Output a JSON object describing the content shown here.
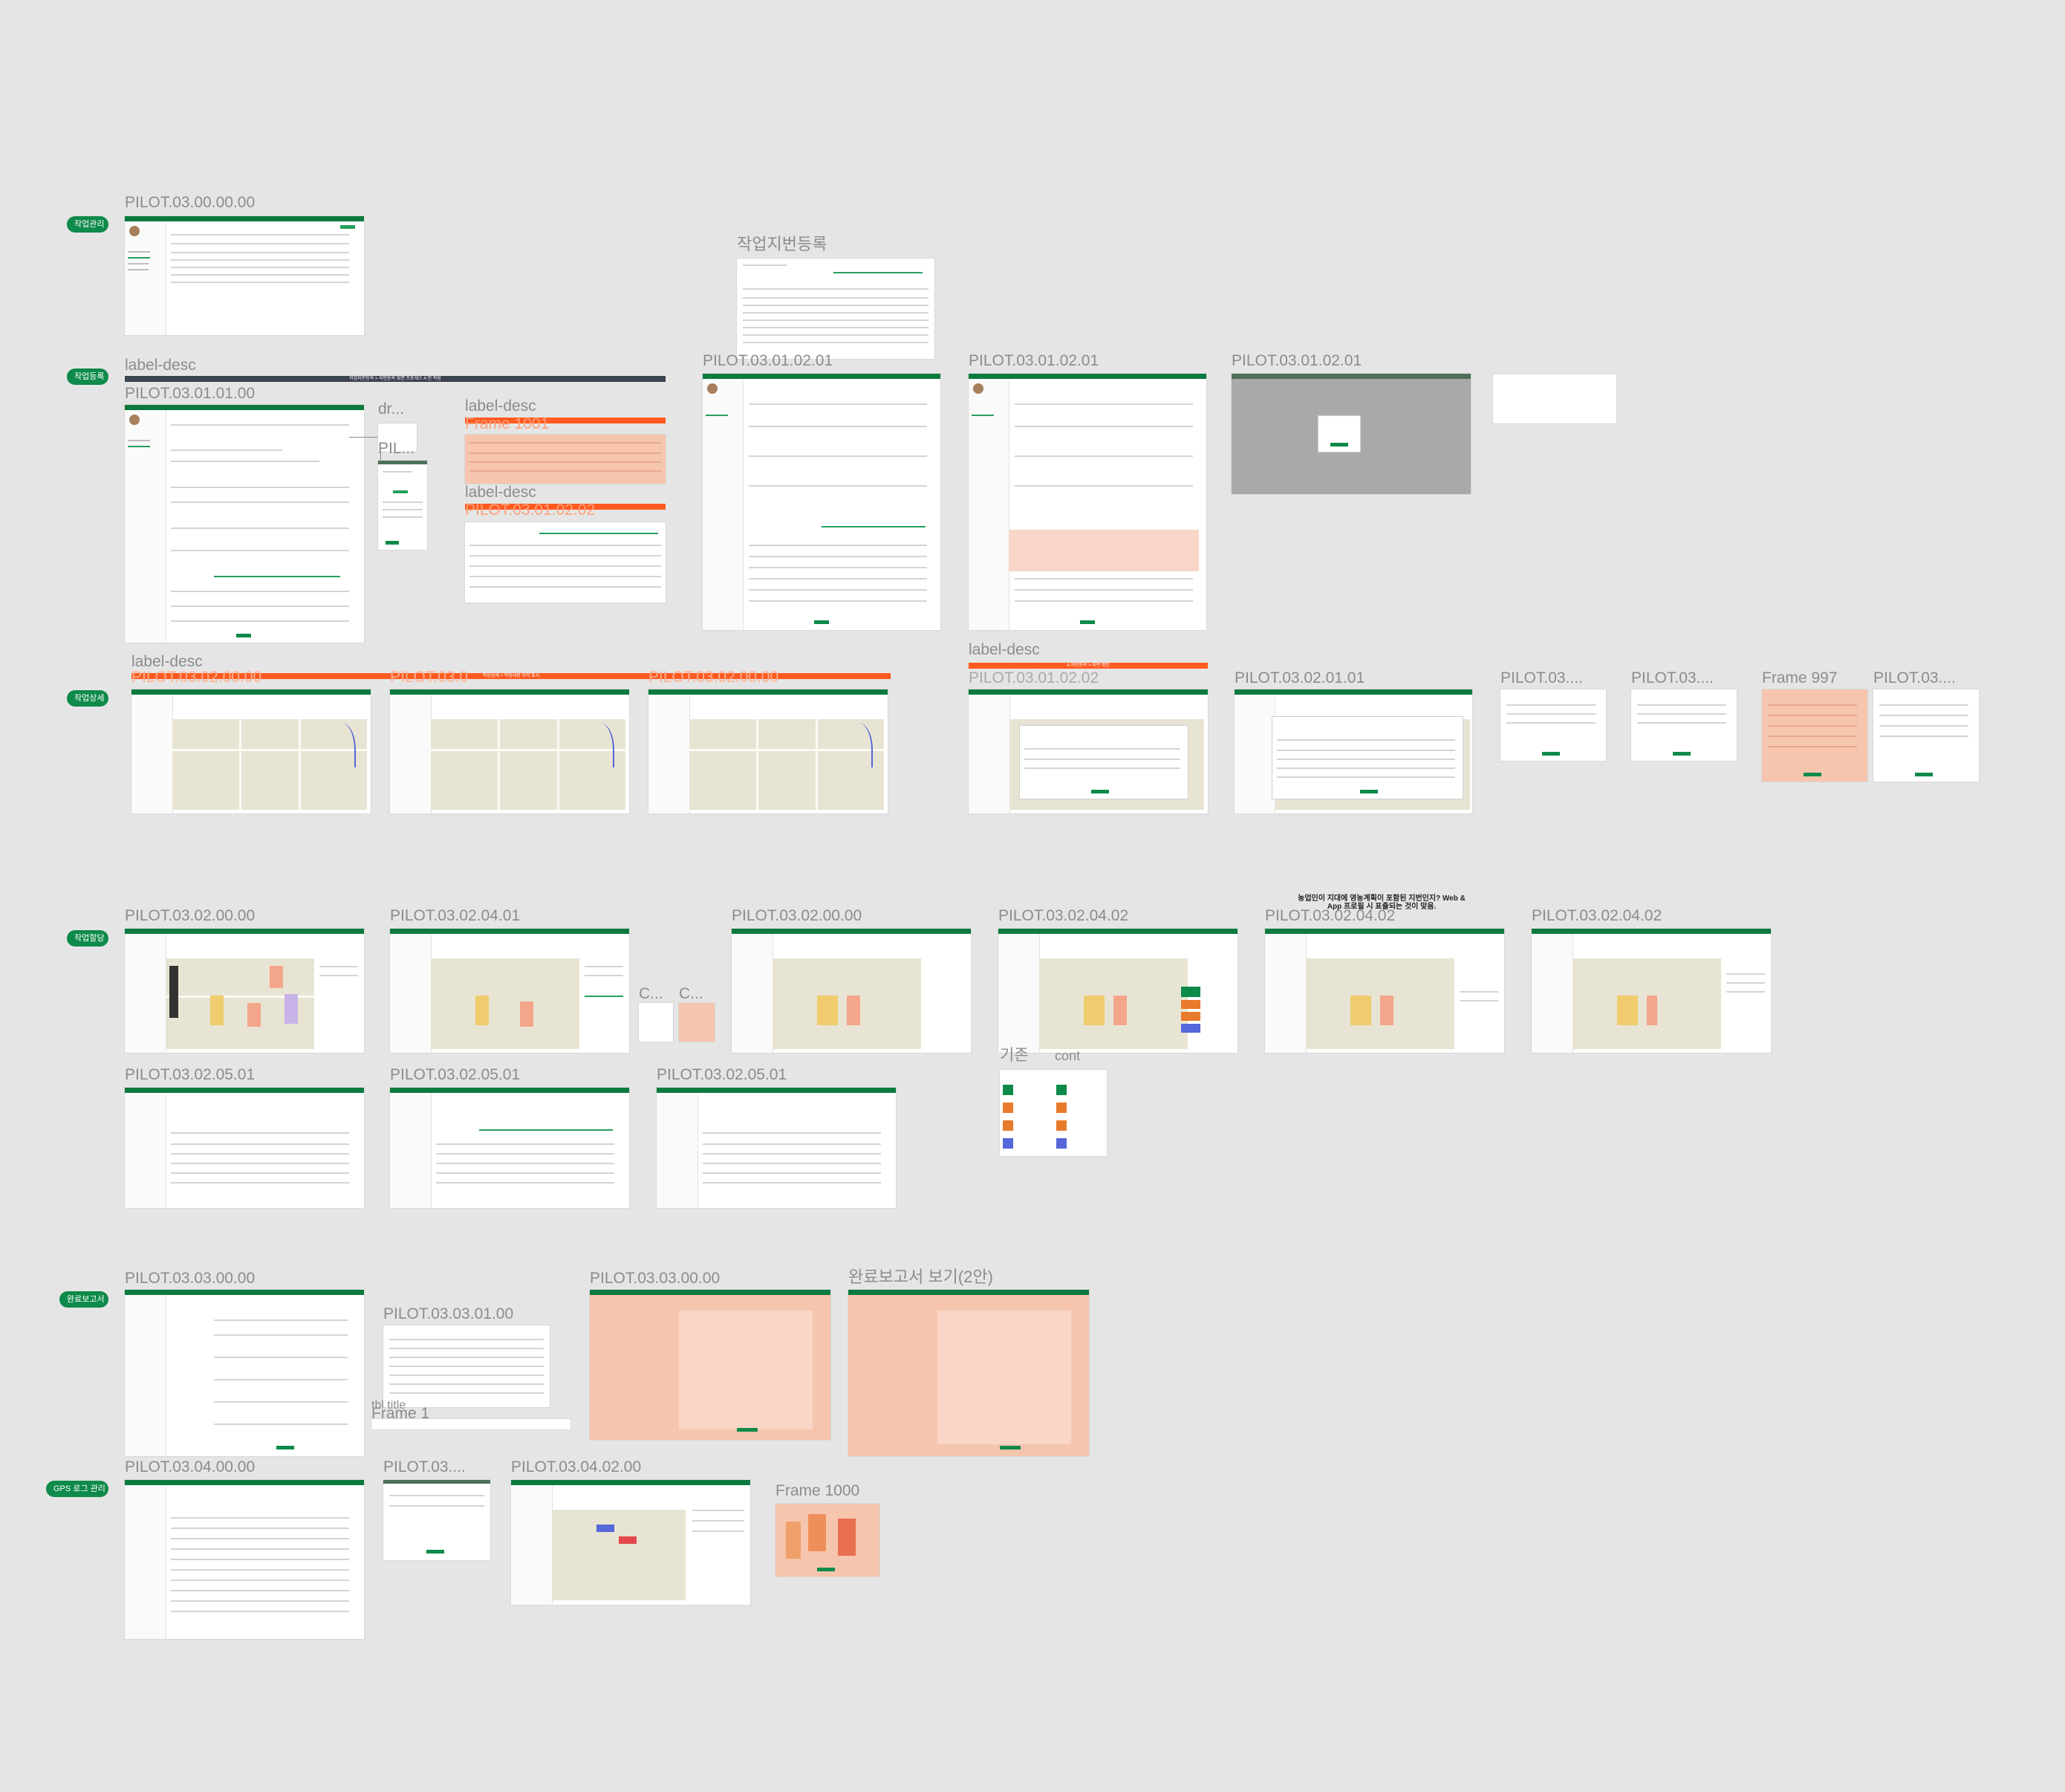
{
  "sections": [
    {
      "label": "작업관리"
    },
    {
      "label": "작업등록"
    },
    {
      "label": "작업상세"
    },
    {
      "label": "작업할당"
    },
    {
      "label": "완료보고서"
    },
    {
      "label": "GPS 로그 관리"
    }
  ],
  "frame_labels": {
    "f1": "PILOT.03.00.00.00",
    "f2": "작업지번등록",
    "f3a": "label-desc",
    "f3b": "PILOT.03.01.01.00",
    "f3c": "dr...",
    "f3d": "PIL...",
    "f3e": "label-desc",
    "f3f": "Frame 1001",
    "f3g": "label-desc",
    "f3h": "PILOT.03.01.02.02",
    "f4": "PILOT.03.01.02.01",
    "f5": "PILOT.03.01.02.01",
    "f6": "PILOT.03.01.02.01",
    "f7a": "label-desc",
    "f7b": "PILOT.03.02.00.00",
    "f7c": "PILOT.03.0",
    "f7d": "PILOT.03.02.00.00",
    "f8a": "label-desc",
    "f8b": "PILOT.03.01.02.02",
    "f9": "PILOT.03.02.01.01",
    "f10": "PILOT.03....",
    "f11": "PILOT.03....",
    "f12": "Frame 997",
    "f13": "PILOT.03....",
    "g1": "PILOT.03.02.00.00",
    "g2": "PILOT.03.02.04.01",
    "g3a": "C...",
    "g3b": "C...",
    "g4": "PILOT.03.02.00.00",
    "g5": "PILOT.03.02.04.02",
    "g6": "PILOT.03.02.04.02",
    "g7": "PILOT.03.02.04.02",
    "g8a": "기존",
    "g8b": "cont",
    "h1": "PILOT.03.02.05.01",
    "h2": "PILOT.03.02.05.01",
    "h3": "PILOT.03.02.05.01",
    "i1": "PILOT.03.03.00.00",
    "i2": "PILOT.03.03.01.00",
    "i2b": "tbl title",
    "i2c": "Frame 1",
    "i3": "PILOT.03.03.00.00",
    "i4": "완료보고서 보기(2안)",
    "j1": "PILOT.03.04.00.00",
    "j2": "PILOT.03....",
    "j3": "PILOT.03.04.02.00",
    "j4": "Frame 1000"
  },
  "banners": {
    "register_desc": "작업지번등록 > 지번등록 화면 프로세스 A 안 적용",
    "detail_desc": "작업상세 > 작업내용 요약 표시",
    "parcel_desc": "A 지번등록 > 지번 확인"
  },
  "annotation_note": "농업인이 지대에 영농계획이 포함된 지번인지? Web & App 프로필 시 표출되는 것이 맞음.",
  "colors": {
    "canvas": "#e5e5e5",
    "brand_green": "#0e8a4a",
    "label_gray": "#8c8c8c",
    "desc_orange": "#ff5a1f",
    "desc_dark": "#3b4350",
    "annotation_salmon": "#f6c5ae",
    "map_bg": "#e8e4d3"
  }
}
